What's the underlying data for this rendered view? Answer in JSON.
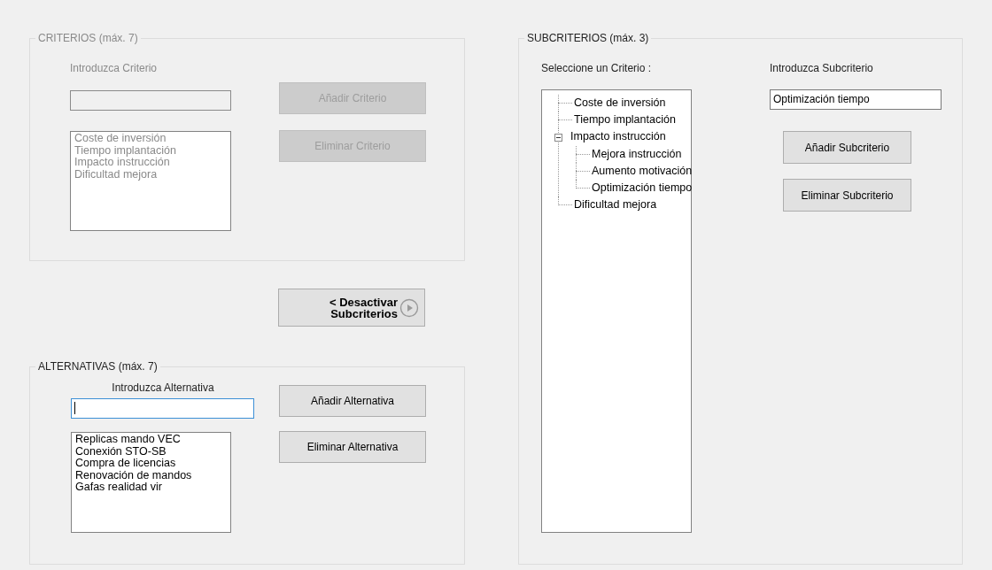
{
  "criterios": {
    "title": "CRITERIOS (máx. 7)",
    "disabled": true,
    "input_label": "Introduzca Criterio",
    "buttons": [
      "Añadir Criterio",
      "Eliminar Criterio"
    ],
    "items": [
      "Coste de inversión",
      "Tiempo implantación",
      "Impacto instrucción",
      "Dificultad mejora"
    ]
  },
  "toggle_button": {
    "label": "< Desactivar\nSubcriterios"
  },
  "alternativas": {
    "title": "ALTERNATIVAS (máx. 7)",
    "disabled": false,
    "input_label": "Introduzca Alternativa",
    "input": {
      "focused": true
    },
    "buttons": [
      "Añadir Alternativa",
      "Eliminar Alternativa"
    ],
    "items": [
      "Replicas mando VEC",
      "Conexión STO-SB",
      "Compra de licencias",
      "Renovación de mandos",
      "Gafas realidad vir"
    ]
  },
  "subcriterios": {
    "title": "SUBCRITERIOS (máx. 3)",
    "tree_label": "Seleccione un Criterio :",
    "input_label": "Introduzca Subcriterio",
    "input": {
      "value": "Optimización tiempo"
    },
    "buttons": [
      "Añadir Subcriterio",
      "Eliminar Subcriterio"
    ],
    "tree": [
      {
        "label": "Coste de inversión"
      },
      {
        "label": "Tiempo implantación"
      },
      {
        "label": "Impacto instrucción",
        "expanded": true,
        "children": [
          {
            "label": "Mejora instrucción"
          },
          {
            "label": "Aumento motivación"
          },
          {
            "label": "Optimización tiempo"
          }
        ]
      },
      {
        "label": "Dificultad mejora"
      }
    ]
  }
}
